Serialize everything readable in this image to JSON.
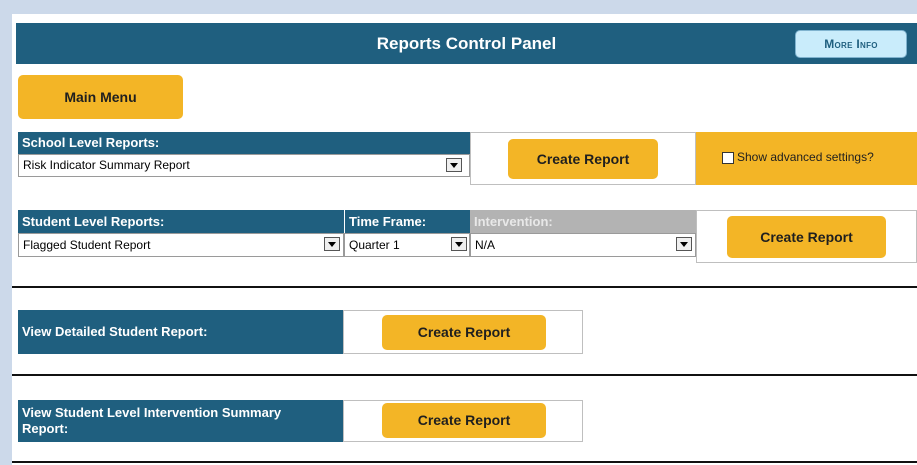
{
  "header": {
    "title": "Reports Control Panel",
    "more_info_label": "More Info"
  },
  "main_menu_label": "Main Menu",
  "school_level": {
    "heading": "School Level Reports:",
    "selected_report": "Risk Indicator Summary Report",
    "create_label": "Create Report",
    "advanced_label": "Show advanced settings?"
  },
  "student_level": {
    "heading": "Student Level Reports:",
    "time_frame_heading": "Time Frame:",
    "intervention_heading": "Intervention:",
    "selected_report": "Flagged Student Report",
    "selected_time_frame": "Quarter 1",
    "selected_intervention": "N/A",
    "create_label": "Create Report"
  },
  "detailed_student": {
    "heading": "View Detailed Student Report:",
    "create_label": "Create Report"
  },
  "intervention_summary": {
    "heading": "View Student Level Intervention Summary Report:",
    "create_label": "Create Report"
  },
  "colors": {
    "header_blue": "#1f5f7f",
    "button_yellow": "#f3b526",
    "more_info_bg": "#c9ecfb",
    "page_bg": "#ccd9ea"
  }
}
